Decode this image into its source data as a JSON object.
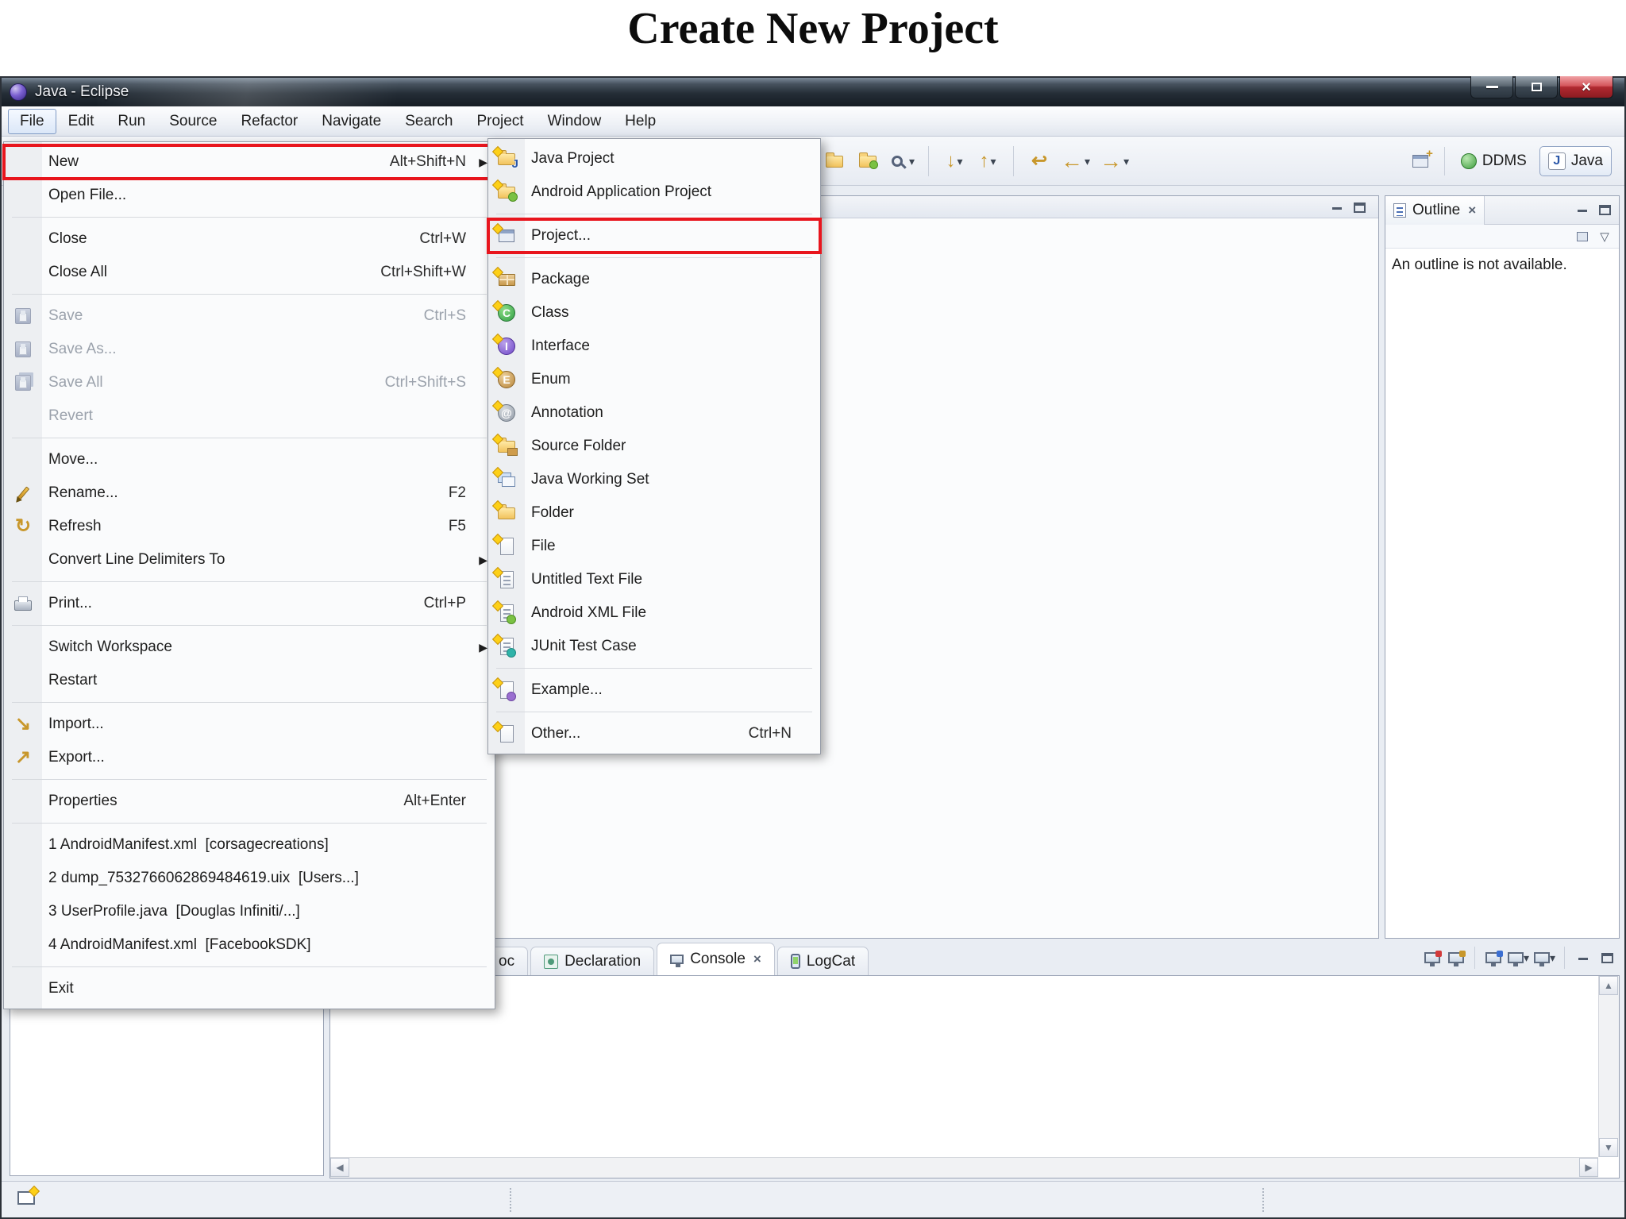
{
  "page_title": "Create New Project",
  "window_title": "Java - Eclipse",
  "menu_bar": [
    "File",
    "Edit",
    "Run",
    "Source",
    "Refactor",
    "Navigate",
    "Search",
    "Project",
    "Window",
    "Help"
  ],
  "file_menu": {
    "items": [
      {
        "label": "New",
        "shortcut": "Alt+Shift+N",
        "has_submenu": true,
        "highlighted": true
      },
      {
        "label": "Open File..."
      },
      {
        "label": "Close",
        "shortcut": "Ctrl+W"
      },
      {
        "label": "Close All",
        "shortcut": "Ctrl+Shift+W"
      },
      {
        "label": "Save",
        "shortcut": "Ctrl+S",
        "disabled": true,
        "icon": "save-icon"
      },
      {
        "label": "Save As...",
        "disabled": true,
        "icon": "save-as-icon"
      },
      {
        "label": "Save All",
        "shortcut": "Ctrl+Shift+S",
        "disabled": true,
        "icon": "save-all-icon"
      },
      {
        "label": "Revert",
        "disabled": true
      },
      {
        "label": "Move..."
      },
      {
        "label": "Rename...",
        "shortcut": "F2",
        "icon": "rename-icon"
      },
      {
        "label": "Refresh",
        "shortcut": "F5",
        "icon": "refresh-icon"
      },
      {
        "label": "Convert Line Delimiters To",
        "has_submenu": true
      },
      {
        "label": "Print...",
        "shortcut": "Ctrl+P",
        "icon": "print-icon"
      },
      {
        "label": "Switch Workspace",
        "has_submenu": true
      },
      {
        "label": "Restart"
      },
      {
        "label": "Import...",
        "icon": "import-icon"
      },
      {
        "label": "Export...",
        "icon": "export-icon"
      },
      {
        "label": "Properties",
        "shortcut": "Alt+Enter"
      },
      {
        "label": "1 AndroidManifest.xml  [corsagecreations]"
      },
      {
        "label": "2 dump_7532766062869484619.uix  [Users...]"
      },
      {
        "label": "3 UserProfile.java  [Douglas Infiniti/...]"
      },
      {
        "label": "4 AndroidManifest.xml  [FacebookSDK]"
      },
      {
        "label": "Exit"
      }
    ]
  },
  "new_menu": {
    "items": [
      {
        "label": "Java Project",
        "icon": "java-project-icon"
      },
      {
        "label": "Android Application Project",
        "icon": "android-application-project-icon"
      },
      {
        "label": "Project...",
        "icon": "project-icon",
        "highlighted": true
      },
      {
        "label": "Package",
        "icon": "package-icon"
      },
      {
        "label": "Class",
        "icon": "class-icon"
      },
      {
        "label": "Interface",
        "icon": "interface-icon"
      },
      {
        "label": "Enum",
        "icon": "enum-icon"
      },
      {
        "label": "Annotation",
        "icon": "annotation-icon"
      },
      {
        "label": "Source Folder",
        "icon": "source-folder-icon"
      },
      {
        "label": "Java Working Set",
        "icon": "java-working-set-icon"
      },
      {
        "label": "Folder",
        "icon": "folder-icon"
      },
      {
        "label": "File",
        "icon": "file-icon"
      },
      {
        "label": "Untitled Text File",
        "icon": "untitled-text-file-icon"
      },
      {
        "label": "Android XML File",
        "icon": "android-xml-file-icon"
      },
      {
        "label": "JUnit Test Case",
        "icon": "junit-test-case-icon"
      },
      {
        "label": "Example...",
        "icon": "example-icon"
      },
      {
        "label": "Other...",
        "shortcut": "Ctrl+N",
        "icon": "other-icon"
      }
    ]
  },
  "perspective_bar": {
    "ddms_label": "DDMS",
    "java_label": "Java"
  },
  "outline_panel": {
    "tab_label": "Outline",
    "message": "An outline is not available."
  },
  "console_area": {
    "tabs": [
      {
        "label": "oc"
      },
      {
        "label": "Declaration"
      },
      {
        "label": "Console",
        "active": true
      },
      {
        "label": "LogCat"
      }
    ]
  },
  "colors": {
    "highlight_red": "#e8151d",
    "close_button_red": "#b12a31"
  },
  "icons": {
    "submenu_arrow": "▶",
    "window_close": "×",
    "tab_close": "×",
    "dropdown": "▾",
    "view_menu": "▽",
    "scroll_up": "▲",
    "scroll_down": "▼",
    "scroll_left": "◀",
    "scroll_right": "▶",
    "back": "←",
    "forward": "→",
    "last_edit": "↩",
    "next_annotation": "↓",
    "prev_annotation": "↑",
    "refresh": "↻",
    "import": "↘",
    "export": "↗"
  }
}
